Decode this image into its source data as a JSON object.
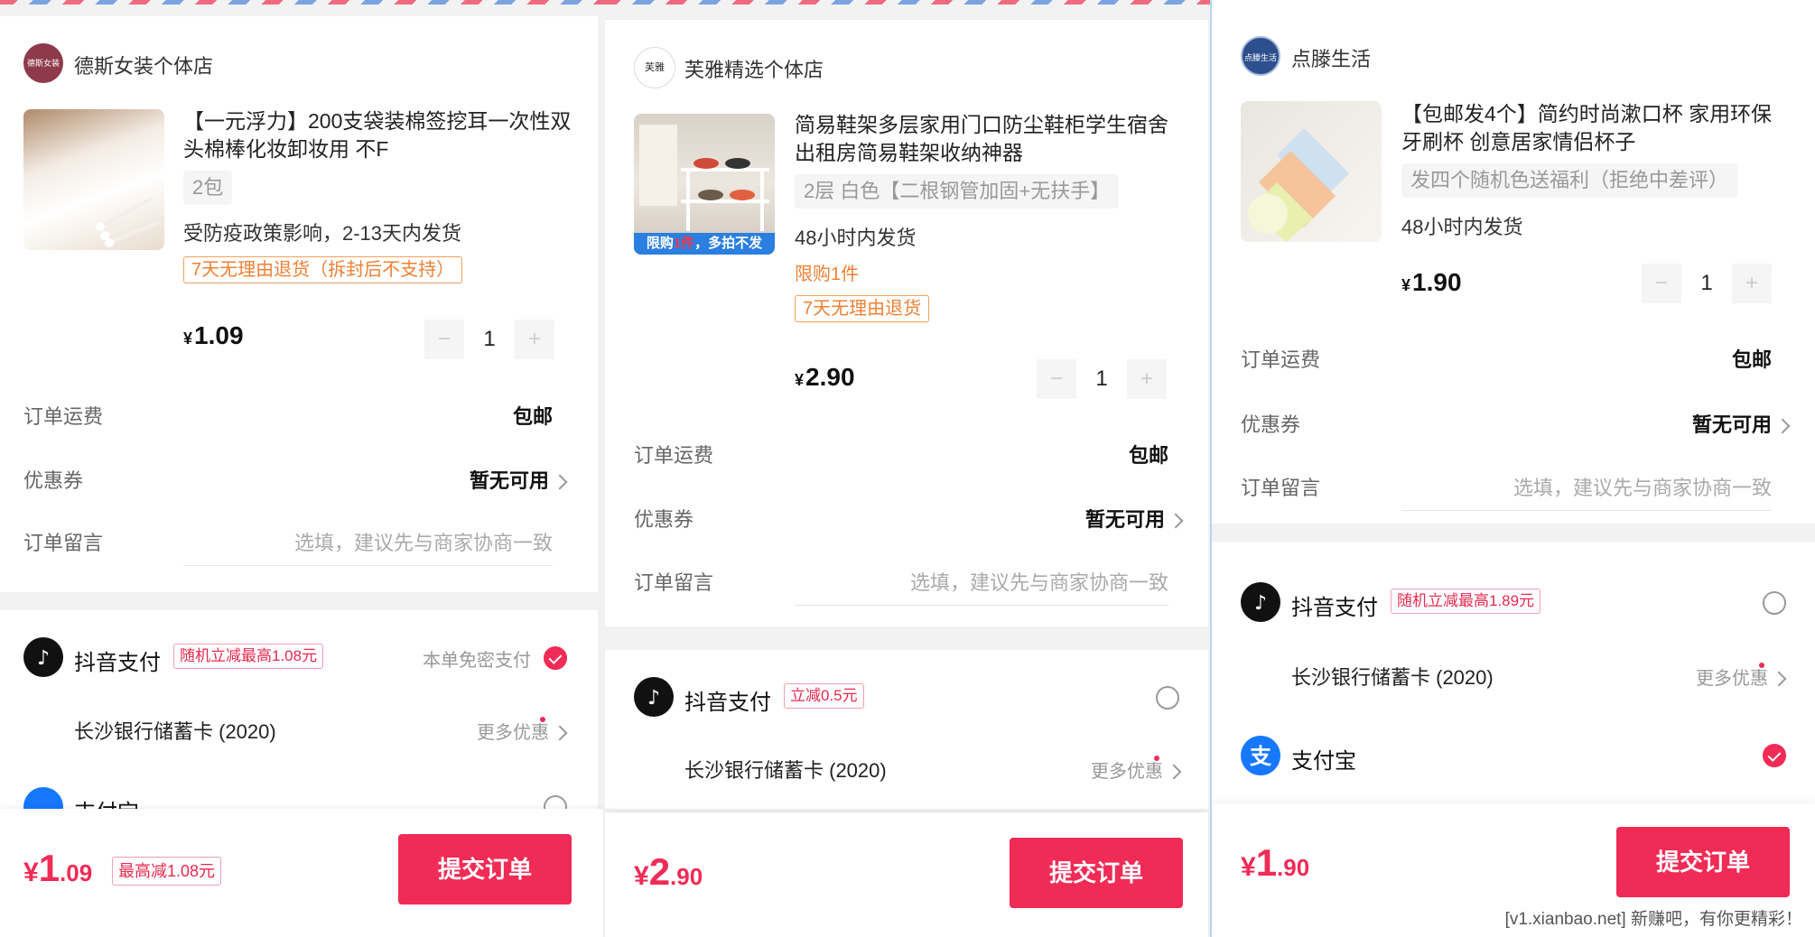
{
  "panels": [
    {
      "shop": {
        "name": "德斯女装个体店",
        "logo_text": "德斯女装"
      },
      "product": {
        "title": "【一元浮力】200支袋装棉签挖耳一次性双头棉棒化妆卸妆用 不F",
        "sku": "2包",
        "shipping_note": "受防疫政策影响，2-13天内发货",
        "return_tag": "7天无理由退货（拆封后不支持）",
        "price_symbol": "¥",
        "price": "1.09",
        "qty": "1"
      },
      "rows": {
        "shipping_label": "订单运费",
        "shipping_value": "包邮",
        "coupon_label": "优惠券",
        "coupon_value": "暂无可用",
        "message_label": "订单留言",
        "message_placeholder": "选填，建议先与商家协商一致"
      },
      "payment": {
        "douyin_label": "抖音支付",
        "douyin_promo": "随机立减最高1.08元",
        "douyin_note": "本单免密支付",
        "bank_label": "长沙银行储蓄卡 (2020)",
        "more_label": "更多优惠",
        "alipay_label": "支付宝"
      },
      "footer": {
        "symbol": "¥",
        "int": "1",
        "dec": ".09",
        "promo": "最高减1.08元",
        "submit": "提交订单"
      }
    },
    {
      "shop": {
        "name": "芙雅精选个体店",
        "logo_text": "芙雅"
      },
      "product": {
        "title": "简易鞋架多层家用门口防尘鞋柜学生宿舍出租房简易鞋架收纳神器",
        "sku": "2层 白色【二根钢管加固+无扶手】",
        "shipping_note": "48小时内发货",
        "limit_note": "限购1件",
        "return_tag": "7天无理由退货",
        "thumb_banner_prefix": "限购",
        "thumb_banner_red": "1件",
        "thumb_banner_suffix": "，多拍不发",
        "price_symbol": "¥",
        "price": "2.90",
        "qty": "1"
      },
      "rows": {
        "shipping_label": "订单运费",
        "shipping_value": "包邮",
        "coupon_label": "优惠券",
        "coupon_value": "暂无可用",
        "message_label": "订单留言",
        "message_placeholder": "选填，建议先与商家协商一致"
      },
      "payment": {
        "douyin_label": "抖音支付",
        "douyin_promo": "立减0.5元",
        "bank_label": "长沙银行储蓄卡 (2020)",
        "more_label": "更多优惠"
      },
      "footer": {
        "symbol": "¥",
        "int": "2",
        "dec": ".90",
        "submit": "提交订单"
      }
    },
    {
      "shop": {
        "name": "点滕生活",
        "logo_text": "点滕生活"
      },
      "product": {
        "title": "【包邮发4个】简约时尚漱口杯 家用环保牙刷杯 创意居家情侣杯子",
        "sku": "发四个随机色送福利（拒绝中差评）",
        "shipping_note": "48小时内发货",
        "price_symbol": "¥",
        "price": "1.90",
        "qty": "1"
      },
      "rows": {
        "shipping_label": "订单运费",
        "shipping_value": "包邮",
        "coupon_label": "优惠券",
        "coupon_value": "暂无可用",
        "message_label": "订单留言",
        "message_placeholder": "选填，建议先与商家协商一致"
      },
      "payment": {
        "douyin_label": "抖音支付",
        "douyin_promo": "随机立减最高1.89元",
        "bank_label": "长沙银行储蓄卡 (2020)",
        "more_label": "更多优惠",
        "alipay_label": "支付宝"
      },
      "footer": {
        "symbol": "¥",
        "int": "1",
        "dec": ".90",
        "submit": "提交订单"
      }
    }
  ],
  "watermark": "[v1.xianbao.net] 新赚吧，有你更精彩！",
  "colors": {
    "accent": "#f02b55",
    "orange": "#f08033",
    "douyin": "#111111",
    "alipay": "#1677ff"
  }
}
